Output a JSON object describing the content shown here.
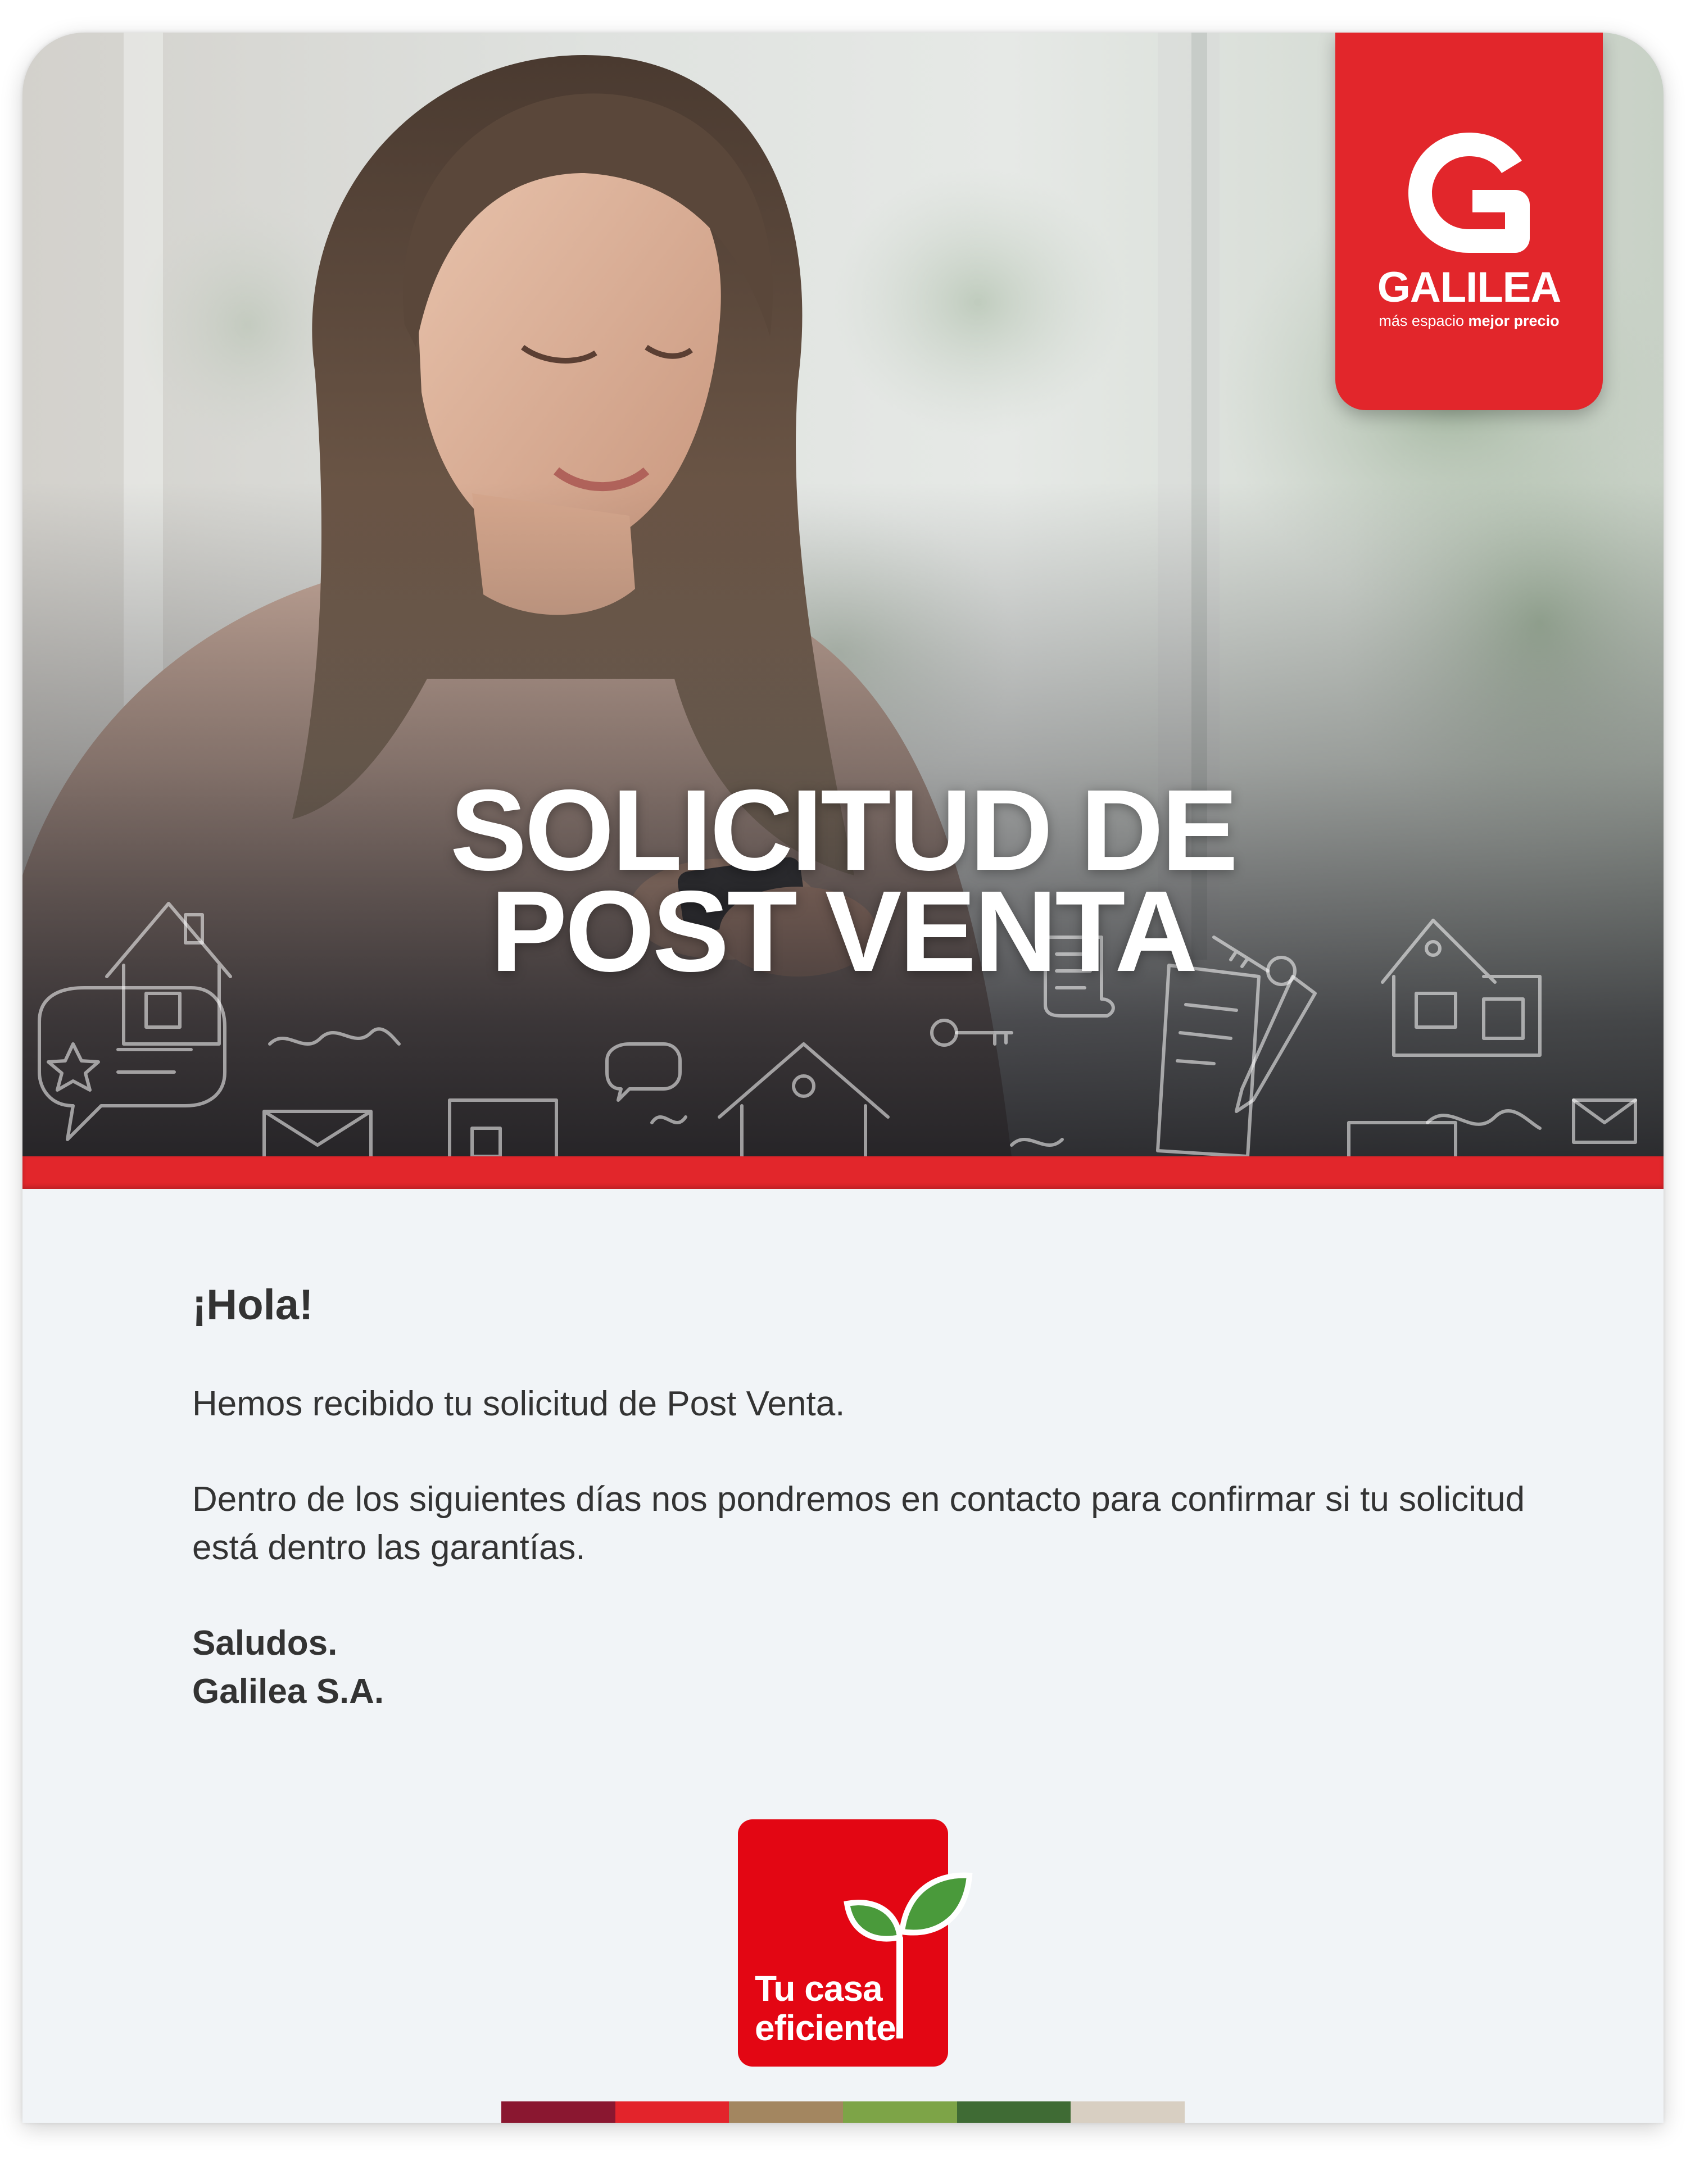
{
  "brand": {
    "name": "GALILEA",
    "tagline_regular": "más espacio",
    "tagline_bold": "mejor precio",
    "red": "#e2262b"
  },
  "hero": {
    "title_line1": "SOLICITUD DE",
    "title_line2": "POST VENTA"
  },
  "message": {
    "greeting": "¡Hola!",
    "paragraph1": "Hemos recibido tu solicitud de Post Venta.",
    "paragraph2": "Dentro de los siguientes días nos pondremos en contacto para confirmar si tu solicitud está dentro las garantías.",
    "closing": "Saludos.",
    "signature": "Galilea S.A."
  },
  "badge": {
    "line1": "Tu casa",
    "line2": "eficiente",
    "icon": "sprout-icon"
  },
  "color_strip": [
    "#8a1730",
    "#e3242b",
    "#a38660",
    "#7da447",
    "#3f6b34",
    "#d8cfc2"
  ]
}
